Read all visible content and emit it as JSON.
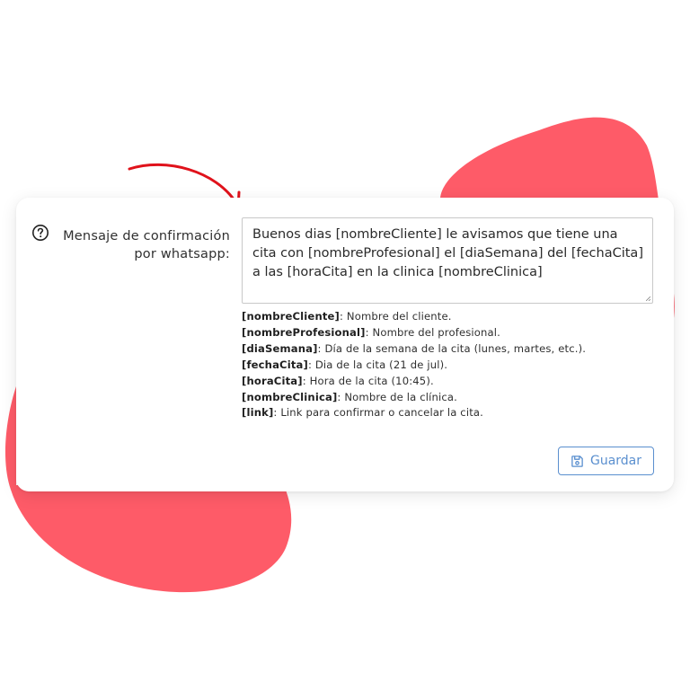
{
  "colors": {
    "blob": "#fe5b68",
    "arrow": "#e0121b",
    "accent": "#5a8fcf",
    "text": "#303030"
  },
  "field": {
    "label": "Mensaje de confirmación por whatsapp:",
    "help_icon": "question-circle-icon",
    "value": "Buenos dias [nombreCliente] le avisamos que tiene una cita con [nombreProfesional] el [diaSemana] del [fechaCita] a las [horaCita] en la clinica [nombreClinica]"
  },
  "legend": [
    {
      "key": "[nombreCliente]",
      "desc": ": Nombre del cliente."
    },
    {
      "key": "[nombreProfesional]",
      "desc": ": Nombre del profesional."
    },
    {
      "key": "[diaSemana]",
      "desc": ": Día de la semana de la cita (lunes, martes, etc.)."
    },
    {
      "key": "[fechaCita]",
      "desc": ": Dia de la cita (21 de jul)."
    },
    {
      "key": "[horaCita]",
      "desc": ": Hora de la cita (10:45)."
    },
    {
      "key": "[nombreClinica]",
      "desc": ": Nombre de la clínica."
    },
    {
      "key": "[link]",
      "desc": ": Link para confirmar o cancelar la cita."
    }
  ],
  "save_button": {
    "label": "Guardar",
    "icon": "floppy-disk-icon"
  }
}
